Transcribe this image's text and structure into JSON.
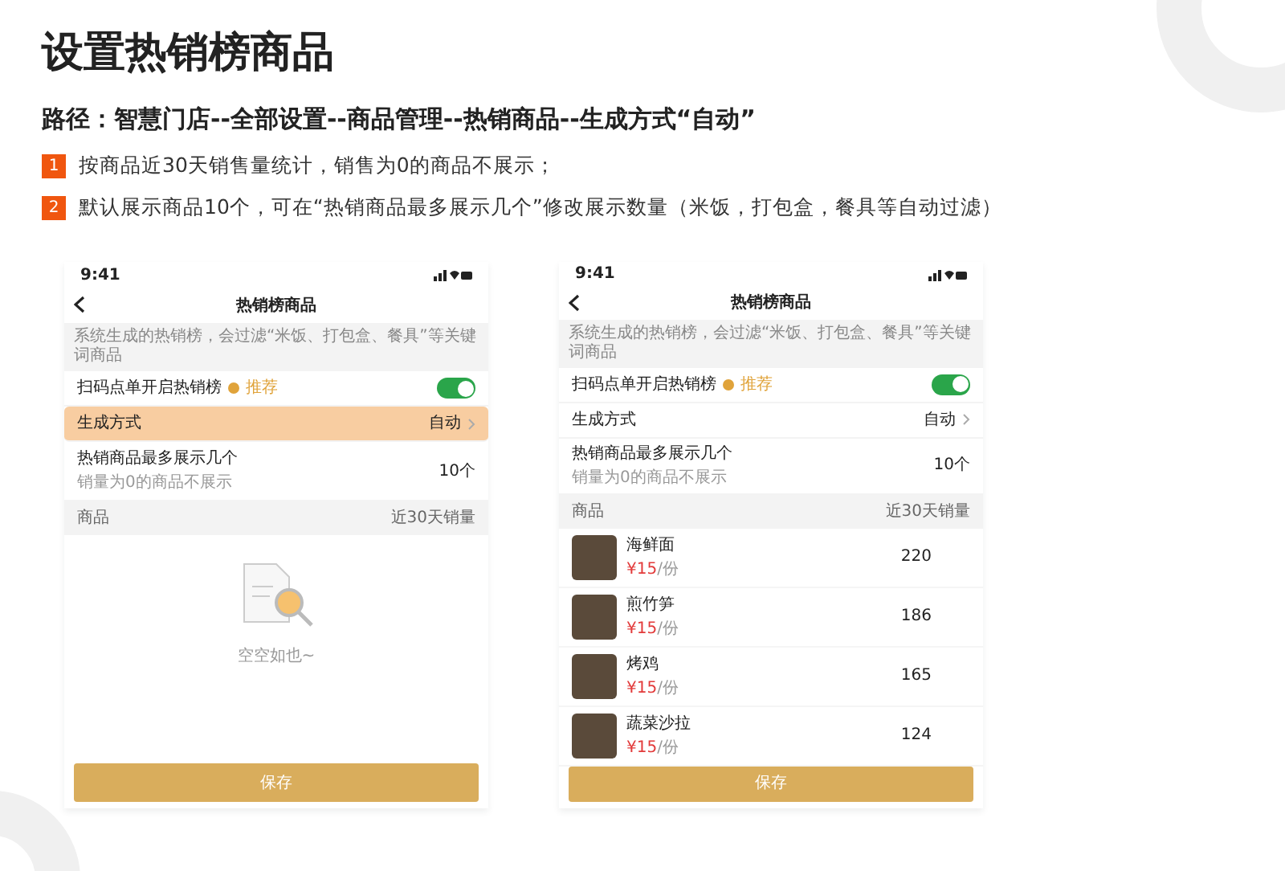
{
  "title": "设置热销榜商品",
  "path": "路径：智慧门店--全部设置--商品管理--热销商品--生成方式“自动”",
  "notes": [
    {
      "number": "1",
      "text": "按商品近30天销售量统计，销售为0的商品不展示；"
    },
    {
      "number": "2",
      "text": "默认展示商品10个，可在“热销商品最多展示几个”修改展示数量（米饭，打包盒，餐具等自动过滤）"
    }
  ],
  "phones": [
    {
      "time": "9:41",
      "nav_title": "热销榜商品",
      "notice": "系统生成的热销榜，会过滤“米饭、打包盒、餐具”等关键词商品",
      "settings": [
        {
          "kind": "toggle",
          "label": "扫码点单开启热销榜",
          "tag": "推荐",
          "on": true,
          "highlighted": false
        },
        {
          "kind": "select",
          "label": "生成方式",
          "value": "自动",
          "highlighted": true
        },
        {
          "kind": "value",
          "label": "热销商品最多展示几个",
          "sub": "销量为0的商品不展示",
          "value": "10个",
          "highlighted": false
        }
      ],
      "list_header": {
        "product": "商品",
        "sales": "近30天销量"
      },
      "empty_text": "空空如也~",
      "save": "保存"
    },
    {
      "time": "9:41",
      "nav_title": "热销榜商品",
      "notice": "系统生成的热销榜，会过滤“米饭、打包盒、餐具”等关键词商品",
      "settings": [
        {
          "kind": "toggle",
          "label": "扫码点单开启热销榜",
          "tag": "推荐",
          "on": true,
          "highlighted": false
        },
        {
          "kind": "select",
          "label": "生成方式",
          "value": "自动",
          "highlighted": false
        },
        {
          "kind": "value",
          "label": "热销商品最多展示几个",
          "sub": "销量为0的商品不展示",
          "value": "10个",
          "highlighted": false
        }
      ],
      "list_header": {
        "product": "商品",
        "sales": "近30天销量"
      },
      "products": [
        {
          "name": "海鲜面",
          "price": "¥15",
          "unit": "/份",
          "sales": "220"
        },
        {
          "name": "煎竹笋",
          "price": "¥15",
          "unit": "/份",
          "sales": "186"
        },
        {
          "name": "烤鸡",
          "price": "¥15",
          "unit": "/份",
          "sales": "165"
        },
        {
          "name": "蔬菜沙拉",
          "price": "¥15",
          "unit": "/份",
          "sales": "124"
        }
      ],
      "save": "保存"
    }
  ]
}
